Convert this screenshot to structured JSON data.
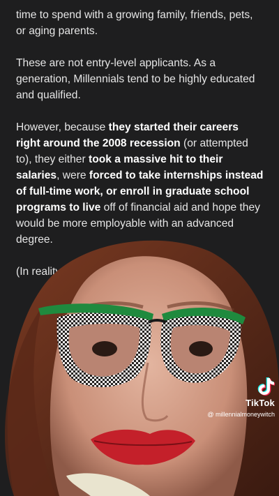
{
  "article": {
    "p1": "time to spend with a growing family, friends, pets, or aging parents.",
    "p2": "These are not entry-level applicants. As a generation, Millennials tend to be highly educated and qualified.",
    "p3": {
      "t1": "However, because ",
      "b1": "they started their careers right around the 2008 recession",
      "t2": " (or attempted to), they either ",
      "b2": "took a massive hit to their salaries",
      "t3": ", were ",
      "b3": "forced to take internships instead of full-time work, or enroll in graduate school programs to live",
      "t4": " off of financial aid and hope they would be more employable with an advanced degree."
    },
    "p4": "(In reality ... e glut in the ma ... for ano"
  },
  "watermark": {
    "brand": "TikTok",
    "handle": "@ millennialmoneywitch"
  },
  "colors": {
    "background": "#1e1e1f",
    "text": "#e6e6e6",
    "glasses_frame": "#1f8a3e"
  },
  "icons": [
    "tiktok-logo-icon"
  ]
}
